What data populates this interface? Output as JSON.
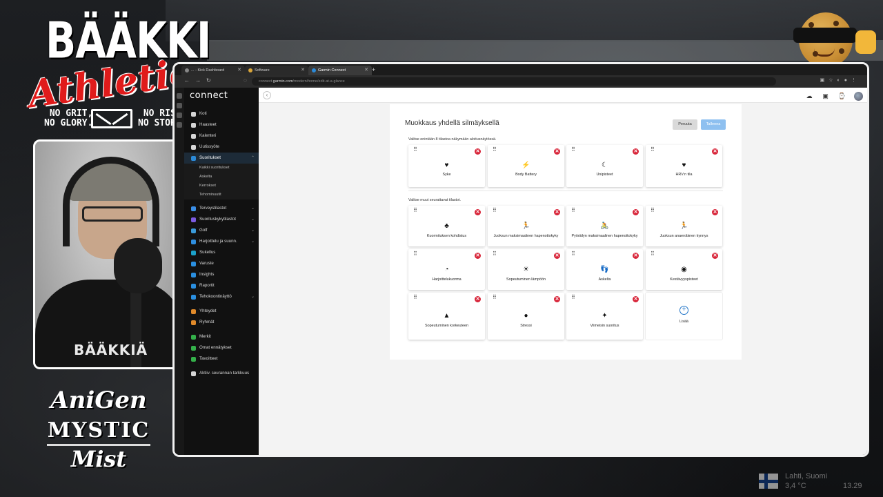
{
  "overlay": {
    "logo_main": "BÄÄKKI",
    "logo_script": "Athletics",
    "tag_left": [
      "NO GRIT,",
      "NO GLORY."
    ],
    "tag_right": [
      "NO RISK,",
      "NO STORY."
    ],
    "brand_line1": "AniGen",
    "brand_line2": "MYSTIC",
    "brand_line3": "Mist",
    "webcam_shirt_text": "BÄÄKKIÄ"
  },
  "taskbar": {
    "location": "Lahti, Suomi",
    "weather": "3,4 °C",
    "time": "13.29"
  },
  "browser": {
    "tabs": [
      {
        "label": "... - Kick Dashboard",
        "active": false
      },
      {
        "label": "Software",
        "active": false
      },
      {
        "label": "Garmin Connect",
        "active": true
      }
    ],
    "new_tab": "+",
    "url_prefix": "connect.",
    "url_domain": "garmin.com",
    "url_path": "/modern/home/edit-at-a-glance"
  },
  "app": {
    "logo": "connect",
    "nav": [
      {
        "label": "Koti",
        "icon": "home-icon",
        "color": "#d6d6d6"
      },
      {
        "label": "Haasteet",
        "icon": "challenge-icon",
        "color": "#d6d6d6"
      },
      {
        "label": "Kalenteri",
        "icon": "calendar-icon",
        "color": "#d6d6d6"
      },
      {
        "label": "Uutissyöte",
        "icon": "newsfeed-icon",
        "color": "#d6d6d6"
      }
    ],
    "activities": {
      "label": "Suoritukset",
      "icon": "activity-icon",
      "color": "#2b8ad8",
      "sub": [
        "Kaikki suoritukset",
        "Askelta",
        "Kerrokset",
        "Tehominuutit"
      ]
    },
    "nav2": [
      {
        "label": "Terveystilastot",
        "icon": "heart-icon",
        "color": "#3a8ee6",
        "chevron": true
      },
      {
        "label": "Suorituskykytilastot",
        "icon": "performance-icon",
        "color": "#7b5be0",
        "chevron": true
      },
      {
        "label": "Golf",
        "icon": "golf-icon",
        "color": "#3a9ad9",
        "chevron": true
      },
      {
        "label": "Harjoittelu ja suunn.",
        "icon": "training-icon",
        "color": "#2f8fe0",
        "chevron": true
      },
      {
        "label": "Sukellus",
        "icon": "dive-icon",
        "color": "#1ba1c9",
        "chevron": false
      },
      {
        "label": "Varuste",
        "icon": "gear-icon",
        "color": "#2a8fe0",
        "chevron": false
      },
      {
        "label": "Insights",
        "icon": "insights-icon",
        "color": "#2a8fe0",
        "chevron": false
      },
      {
        "label": "Raportit",
        "icon": "reports-icon",
        "color": "#2a8fe0",
        "chevron": false
      },
      {
        "label": "Tehokoontinäyttö",
        "icon": "dashboard-icon",
        "color": "#2a8fe0",
        "chevron": true
      }
    ],
    "nav3": [
      {
        "label": "Yhteydet",
        "icon": "connections-icon",
        "color": "#e08a2a"
      },
      {
        "label": "Ryhmät",
        "icon": "groups-icon",
        "color": "#e08a2a"
      }
    ],
    "nav4": [
      {
        "label": "Merkit",
        "icon": "badge-icon",
        "color": "#34b04a"
      },
      {
        "label": "Omat ennätykset",
        "icon": "trophy-icon",
        "color": "#34b04a"
      },
      {
        "label": "Tavoitteet",
        "icon": "goal-icon",
        "color": "#34b04a"
      }
    ],
    "nav5": [
      {
        "label": "Aktiiv. seurannan tarkkuus",
        "icon": "info-icon",
        "color": "#d6d6d6"
      }
    ]
  },
  "page": {
    "title": "Muokkaus yhdellä silmäyksellä",
    "cancel_label": "Peruuta",
    "save_label": "Tallenna",
    "section1_label": "Valitse enintään 8 tilastoa näkymään aloitusnäytössä.",
    "section2_label": "Valitse muut seurattavat tilastot.",
    "selected": [
      {
        "label": "Syke",
        "icon": "♥",
        "icon_name": "heart-icon"
      },
      {
        "label": "Body Battery",
        "icon": "⚡",
        "icon_name": "body-battery-icon"
      },
      {
        "label": "Unipisteet",
        "icon": "☾",
        "icon_name": "sleep-score-icon"
      },
      {
        "label": "HRV:n tila",
        "icon": "♥",
        "icon_name": "hrv-icon"
      }
    ],
    "others": [
      {
        "label": "Kuormituksen kohdistus",
        "icon": "♣",
        "icon_name": "load-focus-icon"
      },
      {
        "label": "Juoksun maksimaalinen hapenottokyky",
        "icon": "🏃",
        "icon_name": "running-vo2max-icon"
      },
      {
        "label": "Pyöräilyn maksimaalinen hapenottokyky",
        "icon": "🚴",
        "icon_name": "cycling-vo2max-icon"
      },
      {
        "label": "Juoksun anaerobinen kynnys",
        "icon": "🏃",
        "icon_name": "lactate-threshold-icon"
      },
      {
        "label": "Harjoittelukuorma",
        "icon": "◔",
        "icon_name": "training-load-icon"
      },
      {
        "label": "Sopeutuminen lämpöön",
        "icon": "☀",
        "icon_name": "heat-acclimation-icon"
      },
      {
        "label": "Askelta",
        "icon": "👣",
        "icon_name": "steps-icon"
      },
      {
        "label": "Kestävyyspisteet",
        "icon": "◉",
        "icon_name": "endurance-score-icon"
      },
      {
        "label": "Sopeutuminen korkeuteen",
        "icon": "▲",
        "icon_name": "altitude-icon"
      },
      {
        "label": "Stressi",
        "icon": "●",
        "icon_name": "stress-icon"
      },
      {
        "label": "Viimeisin suoritus",
        "icon": "✦",
        "icon_name": "last-activity-icon"
      }
    ],
    "add_label": "Lisää"
  }
}
